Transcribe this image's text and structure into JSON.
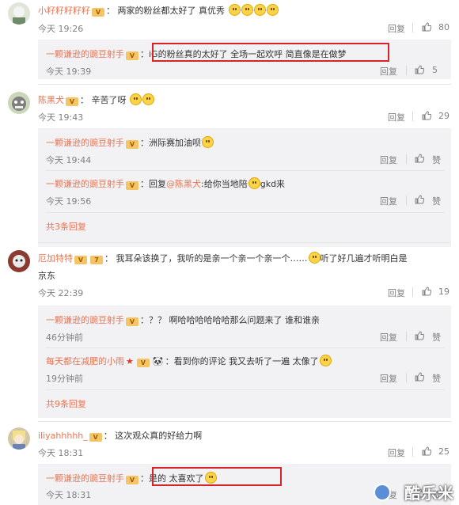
{
  "comments": [
    {
      "user": "小籽籽籽籽籽",
      "text": "两家的粉丝都太好了 真优秀",
      "time": "今天 19:26",
      "reply_label": "回复",
      "likes": "80",
      "replies": [
        {
          "user": "一颗谦逊的豌豆射手",
          "text": "iG的粉丝真的太好了 全场一起欢呼 简直像是在做梦",
          "time": "今天 19:39",
          "reply_label": "回复",
          "likes": "5"
        }
      ]
    },
    {
      "user": "陈黑犬",
      "text": "辛苦了呀",
      "time": "今天 19:43",
      "reply_label": "回复",
      "likes": "29",
      "replies": [
        {
          "user": "一颗谦逊的豌豆射手",
          "text": "洲际赛加油呗",
          "time": "今天 19:44",
          "reply_label": "回复",
          "likes": "赞"
        },
        {
          "user": "一颗谦逊的豌豆射手",
          "prefix": "回复",
          "mention": "@陈黑犬",
          "text": ":给你当地陪",
          "text2": "gkd来",
          "time": "今天 19:56",
          "reply_label": "回复",
          "likes": "赞"
        }
      ],
      "more": "共3条回复"
    },
    {
      "user": "厄加特特",
      "text": "我耳朵该换了，我听的是亲一个亲一个亲一个……",
      "text2": "听了好几遍才听明白是",
      "text3": "京东",
      "time": "今天 22:39",
      "reply_label": "回复",
      "likes": "19",
      "replies": [
        {
          "user": "一颗谦逊的豌豆射手",
          "text": "？？ 啊哈哈哈哈哈哈那么问题来了 谁和谁亲",
          "time": "46分钟前",
          "reply_label": "回复",
          "likes": "赞"
        },
        {
          "user": "每天都在减肥的小雨",
          "text": "看到你的评论 我又去听了一遍 太像了",
          "time": "19分钟前",
          "reply_label": "回复",
          "likes": "赞"
        }
      ],
      "more": "共9条回复"
    },
    {
      "user": "iliyahhhhh_",
      "text": "这次观众真的好给力啊",
      "time": "今天 18:31",
      "reply_label": "回复",
      "likes": "25",
      "replies": [
        {
          "user": "一颗谦逊的豌豆射手",
          "text": "是的 太喜欢了",
          "time": "今天 18:31",
          "reply_label": "回复",
          "likes": "赞"
        }
      ]
    }
  ],
  "watermark": "酷乐米",
  "colors": {
    "username": "#eb7350",
    "muted": "#808080",
    "reply_bg": "#f2f2f5",
    "highlight": "#d8232a"
  }
}
